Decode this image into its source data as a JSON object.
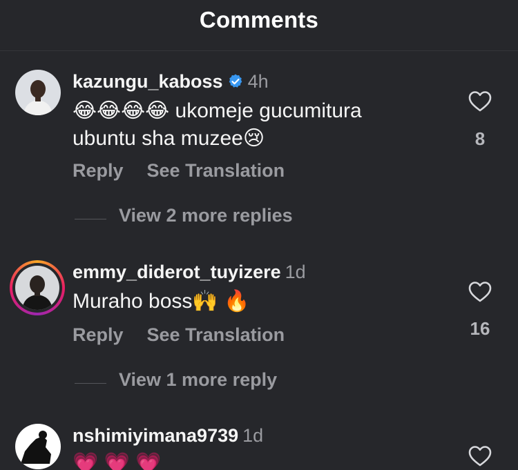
{
  "header": {
    "title": "Comments"
  },
  "comments": [
    {
      "username": "kazungu_kaboss",
      "verified": true,
      "time": "4h",
      "text_line1": "😂😂😂😂 ukomeje gucumitura",
      "text_line2": "ubuntu sha muzee😢",
      "reply": "Reply",
      "see_translation": "See Translation",
      "likes": "8",
      "view_replies": "View 2 more replies"
    },
    {
      "username": "emmy_diderot_tuyizere",
      "verified": false,
      "time": "1d",
      "text_line1": "Muraho boss🙌 🔥",
      "reply": "Reply",
      "see_translation": "See Translation",
      "likes": "16",
      "view_replies": "View 1 more reply"
    },
    {
      "username": "nshimiyimana9739",
      "verified": false,
      "time": "1d",
      "text_line1": "💗 💗 💗"
    }
  ],
  "colors": {
    "background": "#26272b",
    "text": "#f5f5f5",
    "muted": "#9a9ba0",
    "verified": "#3897f0"
  },
  "icons": {
    "like": "heart-outline-icon",
    "verified": "verified-badge-icon"
  }
}
